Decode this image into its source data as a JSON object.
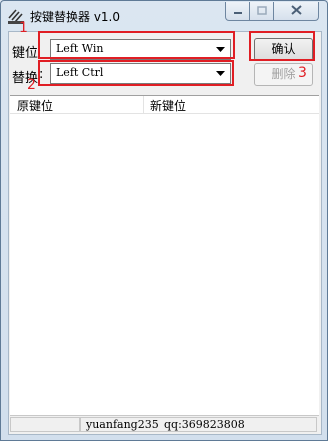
{
  "window": {
    "title": "按键替换器 v1.0"
  },
  "form": {
    "key_label": "键位",
    "key_value": "Left Win",
    "replace_label": "替换",
    "replace_value": "Left Ctrl",
    "confirm_label": "确认",
    "delete_label": "删除"
  },
  "annotations": {
    "one": "1",
    "two": "2",
    "three": "3",
    "color": "#e01e24"
  },
  "list": {
    "columns": [
      "原键位",
      "新键位"
    ],
    "rows": []
  },
  "statusbar": {
    "author": "yuanfang235",
    "qq": "qq:369823808"
  },
  "icons": {
    "app": "keyboard-app-icon",
    "minimize": "minimize-icon",
    "maximize": "maximize-icon",
    "close": "close-icon",
    "dropdown": "chevron-down-icon"
  }
}
